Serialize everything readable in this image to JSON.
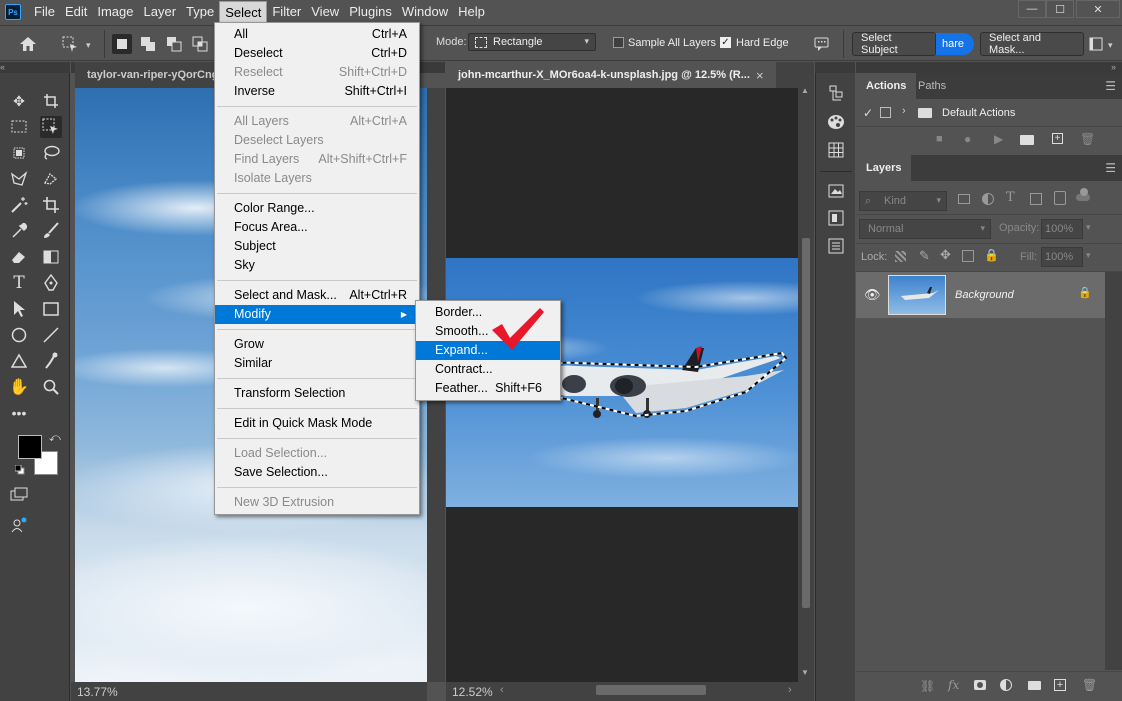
{
  "menubar": {
    "logo": "Ps",
    "items": [
      "File",
      "Edit",
      "Image",
      "Layer",
      "Type",
      "Select",
      "Filter",
      "View",
      "Plugins",
      "Window",
      "Help"
    ],
    "active": "Select"
  },
  "window_controls": {
    "minimize": "—",
    "maximize": "☐",
    "close": "✕"
  },
  "options_bar": {
    "mode_label": "Mode:",
    "mode_value": "Rectangle",
    "sample_all_layers": {
      "label": "Sample All Layers",
      "checked": false
    },
    "hard_edge": {
      "label": "Hard Edge",
      "checked": true
    },
    "select_subject_label": "Select Subject",
    "share_label": "hare",
    "select_and_mask_label": "Select and Mask..."
  },
  "documents": [
    {
      "title": "taylor-van-riper-yQorCng",
      "zoom": "13.77%"
    },
    {
      "title": "john-mcarthur-X_MOr6oa4-k-unsplash.jpg @ 12.5% (R...",
      "zoom": "12.52%",
      "close": "×"
    }
  ],
  "select_menu": {
    "groups": [
      [
        {
          "label": "All",
          "shortcut": "Ctrl+A",
          "enabled": true
        },
        {
          "label": "Deselect",
          "shortcut": "Ctrl+D",
          "enabled": true
        },
        {
          "label": "Reselect",
          "shortcut": "Shift+Ctrl+D",
          "enabled": false
        },
        {
          "label": "Inverse",
          "shortcut": "Shift+Ctrl+I",
          "enabled": true
        }
      ],
      [
        {
          "label": "All Layers",
          "shortcut": "Alt+Ctrl+A",
          "enabled": false
        },
        {
          "label": "Deselect Layers",
          "shortcut": "",
          "enabled": false
        },
        {
          "label": "Find Layers",
          "shortcut": "Alt+Shift+Ctrl+F",
          "enabled": false
        },
        {
          "label": "Isolate Layers",
          "shortcut": "",
          "enabled": false
        }
      ],
      [
        {
          "label": "Color Range...",
          "shortcut": "",
          "enabled": true
        },
        {
          "label": "Focus Area...",
          "shortcut": "",
          "enabled": true
        },
        {
          "label": "Subject",
          "shortcut": "",
          "enabled": true
        },
        {
          "label": "Sky",
          "shortcut": "",
          "enabled": true
        }
      ],
      [
        {
          "label": "Select and Mask...",
          "shortcut": "Alt+Ctrl+R",
          "enabled": true
        },
        {
          "label": "Modify",
          "shortcut": "",
          "enabled": true,
          "submenu": true,
          "highlighted": true
        }
      ],
      [
        {
          "label": "Grow",
          "shortcut": "",
          "enabled": true
        },
        {
          "label": "Similar",
          "shortcut": "",
          "enabled": true
        }
      ],
      [
        {
          "label": "Transform Selection",
          "shortcut": "",
          "enabled": true
        }
      ],
      [
        {
          "label": "Edit in Quick Mask Mode",
          "shortcut": "",
          "enabled": true
        }
      ],
      [
        {
          "label": "Load Selection...",
          "shortcut": "",
          "enabled": false
        },
        {
          "label": "Save Selection...",
          "shortcut": "",
          "enabled": true
        }
      ],
      [
        {
          "label": "New 3D Extrusion",
          "shortcut": "",
          "enabled": false
        }
      ]
    ]
  },
  "modify_submenu": [
    {
      "label": "Border...",
      "shortcut": "",
      "highlighted": false
    },
    {
      "label": "Smooth...",
      "shortcut": "",
      "highlighted": false
    },
    {
      "label": "Expand...",
      "shortcut": "",
      "highlighted": true
    },
    {
      "label": "Contract...",
      "shortcut": "",
      "highlighted": false
    },
    {
      "label": "Feather...",
      "shortcut": "Shift+F6",
      "highlighted": false
    }
  ],
  "actions_panel": {
    "tabs": [
      "Actions",
      "Paths"
    ],
    "active_tab": "Actions",
    "sets": [
      {
        "label": "Default Actions"
      }
    ]
  },
  "layers_panel": {
    "tab": "Layers",
    "filter_label": "Kind",
    "blend_mode": "Normal",
    "opacity_label": "Opacity:",
    "opacity_value": "100%",
    "lock_label": "Lock:",
    "fill_label": "Fill:",
    "fill_value": "100%",
    "layers": [
      {
        "name": "Background",
        "visible": true,
        "locked": true
      }
    ]
  },
  "colors": {
    "accent": "#0078d7",
    "check_mark": "#e8182b",
    "share_button": "#1473e6"
  }
}
